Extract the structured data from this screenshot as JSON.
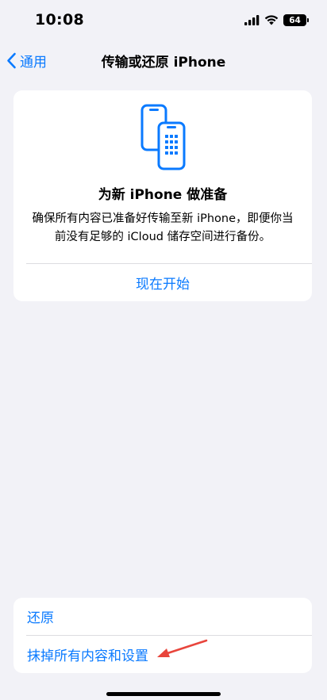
{
  "status": {
    "time": "10:08",
    "battery": "64"
  },
  "nav": {
    "back_label": "通用",
    "title": "传输或还原 iPhone"
  },
  "prepare_card": {
    "title": "为新 iPhone 做准备",
    "description": "确保所有内容已准备好传输至新 iPhone，即便你当前没有足够的 iCloud 储存空间进行备份。",
    "start_label": "现在开始"
  },
  "actions": {
    "reset_label": "还原",
    "erase_label": "抹掉所有内容和设置"
  },
  "colors": {
    "accent": "#0a7aff",
    "background": "#f2f2f7",
    "annotation": "#e8453c"
  },
  "icons": {
    "back": "chevron-left-icon",
    "transfer": "phone-transfer-icon",
    "signal": "cellular-signal-icon",
    "wifi": "wifi-icon",
    "battery": "battery-icon"
  }
}
